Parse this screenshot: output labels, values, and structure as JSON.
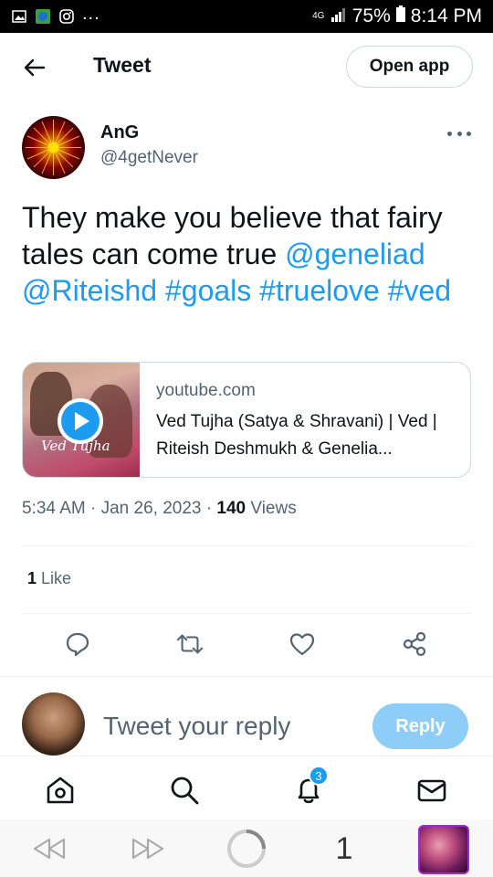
{
  "status_bar": {
    "network": "4G",
    "battery": "75%",
    "time": "8:14 PM",
    "overflow": "..."
  },
  "header": {
    "title": "Tweet",
    "open_app_label": "Open app"
  },
  "tweet": {
    "author_name": "AnG",
    "author_handle": "@4getNever",
    "text_plain": "They make you believe that fairy tales can come true",
    "mentions": [
      "@geneliad",
      "@Riteishd"
    ],
    "hashtags": [
      "#goals",
      "#truelove",
      "#ved"
    ],
    "card": {
      "domain": "youtube.com",
      "title": "Ved Tujha (Satya & Shravani) | Ved | Riteish Deshmukh & Genelia...",
      "thumb_caption": "Ved Tujha"
    },
    "time": "5:34 AM",
    "date": "Jan 26, 2023",
    "views_count": "140",
    "views_label": "Views",
    "likes_count": "1",
    "likes_label": "Like"
  },
  "reply": {
    "placeholder": "Tweet your reply",
    "button_label": "Reply"
  },
  "bottom_nav": {
    "items": [
      "home-icon",
      "search-icon",
      "notifications-icon",
      "messages-icon"
    ],
    "notification_badge": "3"
  },
  "browser_bar": {
    "tab_count": "1"
  },
  "colors": {
    "accent": "#1d9bf0",
    "text": "#0f1419",
    "secondary": "#536471",
    "reply_button": "#8ecdf8"
  }
}
